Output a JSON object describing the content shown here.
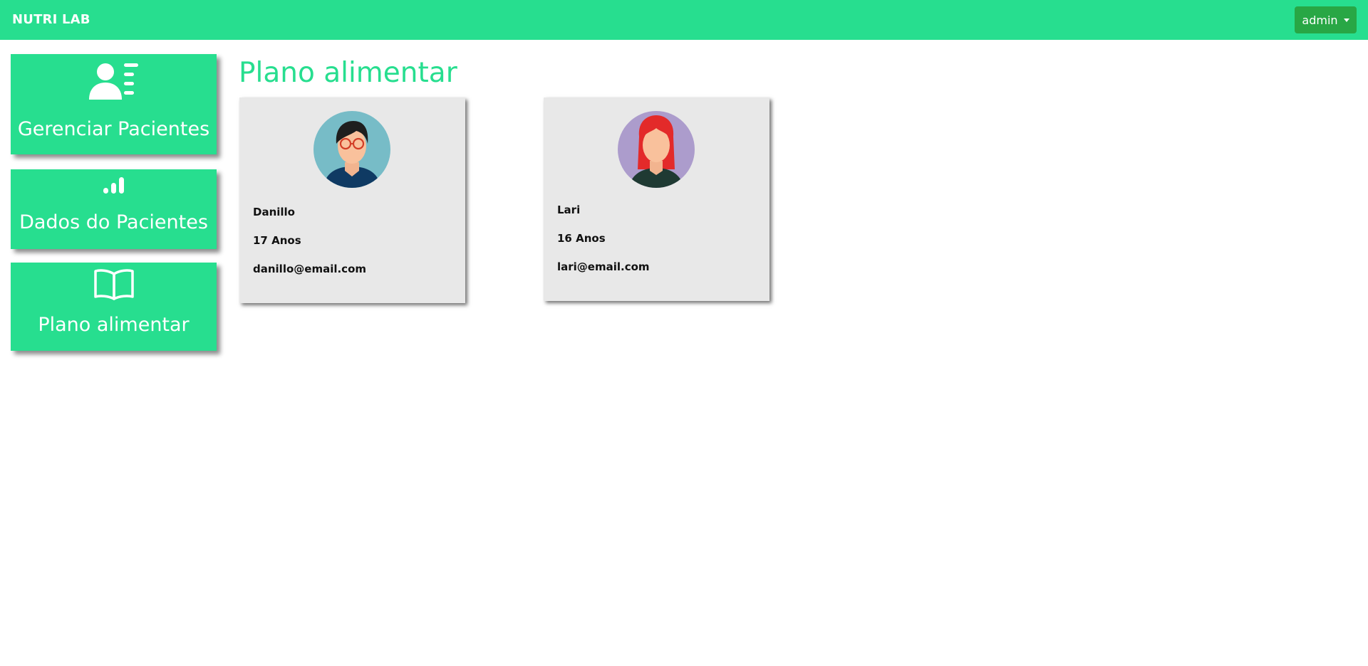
{
  "navbar": {
    "brand": "NUTRI LAB",
    "user_label": "admin",
    "bg_color": "#27de8f",
    "user_button_color": "#28a745"
  },
  "sidebar": {
    "items": [
      {
        "label": "Gerenciar Pacientes",
        "icon": "user-list-icon"
      },
      {
        "label": "Dados do Pacientes",
        "icon": "signal-bars-icon"
      },
      {
        "label": "Plano alimentar",
        "icon": "open-book-icon"
      }
    ]
  },
  "main": {
    "title": "Plano alimentar",
    "patients": [
      {
        "name": "Danillo",
        "age": "17 Anos",
        "email": "danillo@email.com",
        "avatar": "male-avatar-glasses"
      },
      {
        "name": "Lari",
        "age": "16 Anos",
        "email": "lari@email.com",
        "avatar": "female-avatar-red-hair"
      }
    ]
  },
  "colors": {
    "accent": "#27de8f",
    "card_bg": "#e8e8e8"
  }
}
